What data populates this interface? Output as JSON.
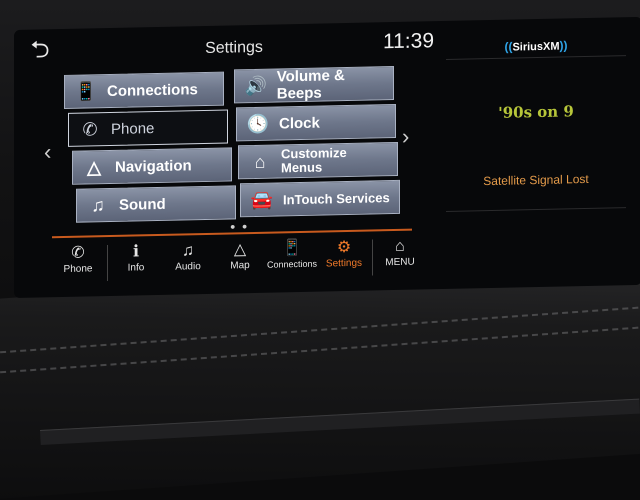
{
  "header": {
    "back_icon": "back-arrow-icon",
    "title": "Settings",
    "time": "11:39"
  },
  "menu": {
    "tiles": [
      {
        "label": "Connections",
        "icon": "phone-connect-icon"
      },
      {
        "label": "Volume & Beeps",
        "icon": "speaker-icon"
      },
      {
        "label": "Phone",
        "icon": "handset-icon",
        "selected": true
      },
      {
        "label": "Clock",
        "icon": "clock-icon"
      },
      {
        "label": "Navigation",
        "icon": "navigation-icon"
      },
      {
        "label": "Customize Menus",
        "icon": "home-icon"
      },
      {
        "label": "Sound",
        "icon": "music-note-icon"
      },
      {
        "label": "InTouch Services",
        "icon": "car-service-icon"
      }
    ],
    "prev_arrow": "‹",
    "next_arrow": "›",
    "page_dots": "● ●"
  },
  "bottom_nav": {
    "items": [
      {
        "label": "Phone",
        "icon": "handset-icon"
      },
      {
        "label": "Info",
        "icon": "info-icon"
      },
      {
        "label": "Audio",
        "icon": "music-icon"
      },
      {
        "label": "Map",
        "icon": "map-arrow-icon"
      },
      {
        "label": "Connections",
        "icon": "connections-icon"
      },
      {
        "label": "Settings",
        "icon": "gear-icon",
        "active": true
      },
      {
        "label": "MENU",
        "icon": "home-icon"
      }
    ],
    "active_color": "#f07a2a"
  },
  "radio": {
    "brand": "SiriusXM",
    "channel": "'90s on 9",
    "status": "Satellite Signal Lost",
    "status_color": "#e39a4a"
  }
}
